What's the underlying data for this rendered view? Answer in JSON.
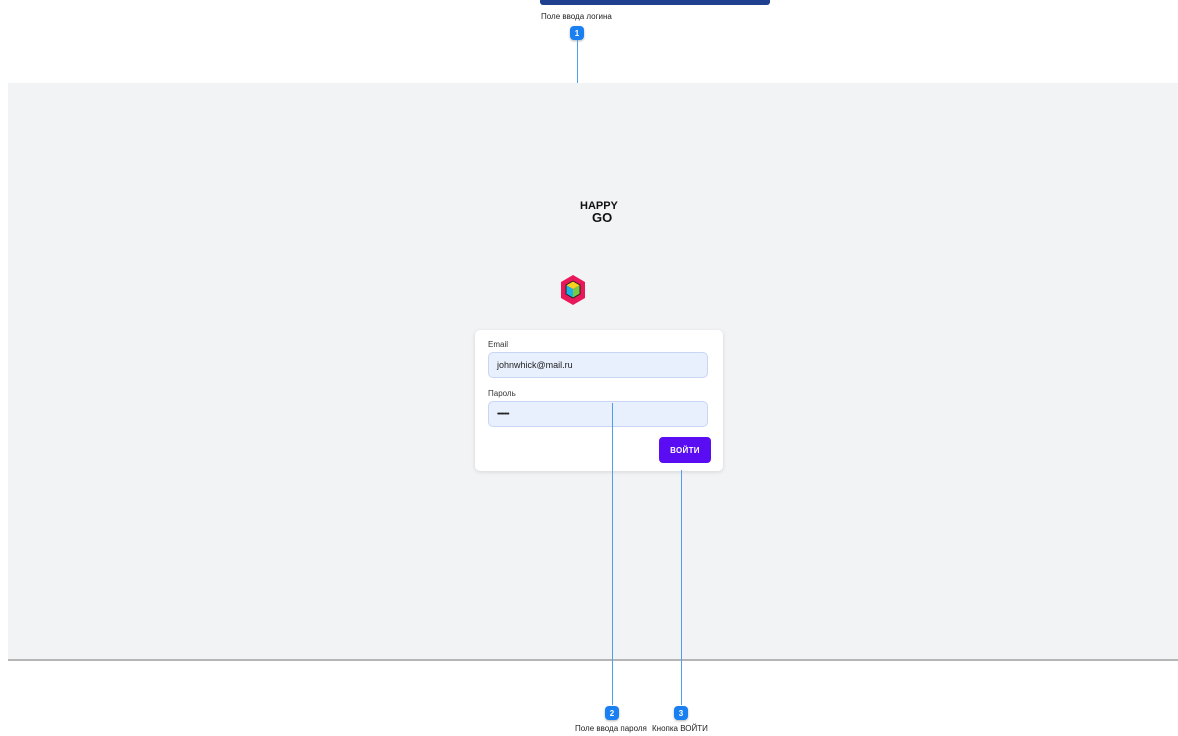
{
  "callouts": [
    {
      "number": "1",
      "label": "Поле ввода логина"
    },
    {
      "number": "2",
      "label": "Поле ввода пароля"
    },
    {
      "number": "3",
      "label": "Кнопка ВОЙТИ"
    }
  ],
  "brand": {
    "line1": "HAPPY",
    "line2": "GO"
  },
  "login_form": {
    "email_label": "Email",
    "email_value": "johnwhick@mail.ru",
    "password_label": "Пароль",
    "password_value": "••••••••",
    "submit_label": "ВОЙТИ"
  },
  "colors": {
    "accent": "#5a0df2",
    "callout": "#1a7ff0",
    "input_bg": "#e8effd",
    "screen_bg": "#f2f3f5"
  }
}
